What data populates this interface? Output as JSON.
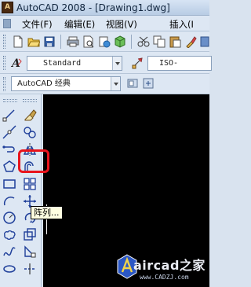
{
  "window": {
    "app_icon_text": "A",
    "title": "AutoCAD 2008 - [Drawing1.dwg]"
  },
  "menu": {
    "items": [
      {
        "label": "文件(F)"
      },
      {
        "label": "编辑(E)"
      },
      {
        "label": "视图(V)"
      },
      {
        "label": "插入(I"
      }
    ]
  },
  "styles_toolbar": {
    "text_style_value": "Standard",
    "dim_style_value": "ISO-"
  },
  "workspace_toolbar": {
    "workspace_value": "AutoCAD 经典"
  },
  "tooltip": {
    "text": "阵列..."
  },
  "watermark": {
    "text": "aircad之家",
    "url": "www.CADZJ.com"
  },
  "colors": {
    "highlight": "#e8141c",
    "canvas": "#000000",
    "toolbar_bg": "#dde7f3"
  }
}
